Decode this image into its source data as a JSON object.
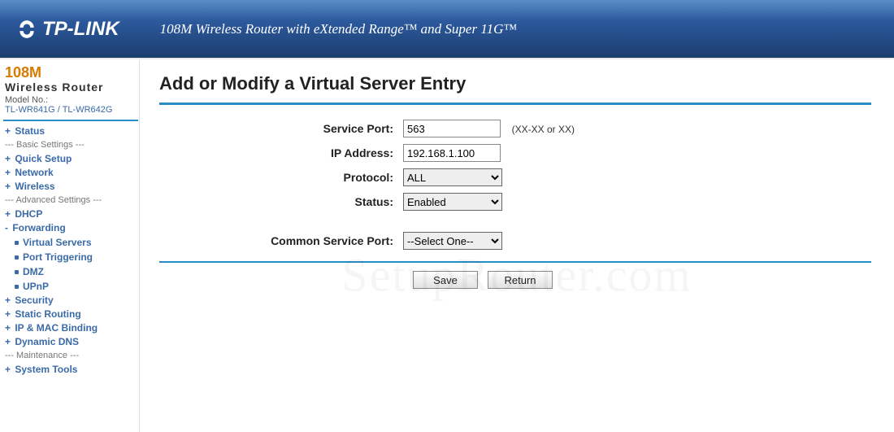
{
  "header": {
    "brand": "TP-LINK",
    "tagline_html": "108M Wireless Router with eXtended Range™ and Super 11G™"
  },
  "sidebar": {
    "product_line1": "108M",
    "product_line2": "Wireless  Router",
    "model_label": "Model No.:",
    "model": "TL-WR641G / TL-WR642G",
    "items": [
      {
        "type": "link",
        "label": "Status"
      },
      {
        "type": "cat",
        "label": "--- Basic Settings ---"
      },
      {
        "type": "link",
        "label": "Quick Setup"
      },
      {
        "type": "link",
        "label": "Network"
      },
      {
        "type": "link",
        "label": "Wireless"
      },
      {
        "type": "cat",
        "label": "--- Advanced Settings ---"
      },
      {
        "type": "link",
        "label": "DHCP"
      },
      {
        "type": "link",
        "label": "Forwarding",
        "active": true
      },
      {
        "type": "sub",
        "label": "Virtual Servers"
      },
      {
        "type": "sub",
        "label": "Port Triggering"
      },
      {
        "type": "sub",
        "label": "DMZ"
      },
      {
        "type": "sub",
        "label": "UPnP"
      },
      {
        "type": "link",
        "label": "Security"
      },
      {
        "type": "link",
        "label": "Static Routing"
      },
      {
        "type": "link",
        "label": "IP & MAC Binding"
      },
      {
        "type": "link",
        "label": "Dynamic DNS"
      },
      {
        "type": "cat",
        "label": "--- Maintenance ---"
      },
      {
        "type": "link",
        "label": "System Tools"
      }
    ]
  },
  "main": {
    "title": "Add or Modify a Virtual Server Entry",
    "fields": {
      "service_port": {
        "label": "Service Port:",
        "value": "563",
        "hint": "(XX-XX or XX)"
      },
      "ip_address": {
        "label": "IP Address:",
        "value": "192.168.1.100"
      },
      "protocol": {
        "label": "Protocol:",
        "value": "ALL"
      },
      "status": {
        "label": "Status:",
        "value": "Enabled"
      },
      "common_port": {
        "label": "Common Service Port:",
        "value": "--Select One--"
      }
    },
    "buttons": {
      "save": "Save",
      "return": "Return"
    }
  },
  "watermark": "SetupRouter.com"
}
